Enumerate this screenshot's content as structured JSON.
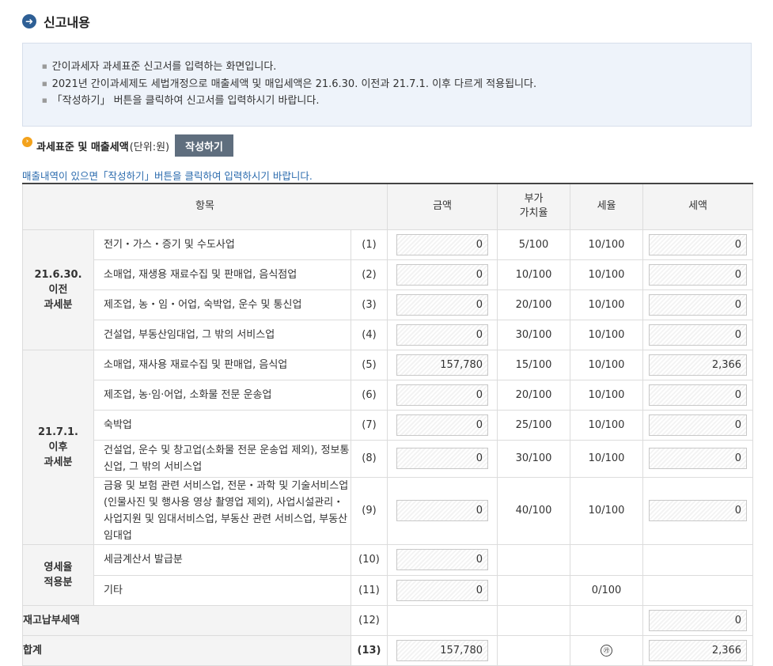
{
  "header": {
    "title": "신고내용",
    "icon": "arrow-right-circle-icon"
  },
  "notice": [
    "간이과세자 과세표준 신고서를 입력하는 화면입니다.",
    "2021년 간이과세제도 세법개정으로 매출세액 및 매입세액은 21.6.30. 이전과 21.7.1. 이후 다르게 적용됩니다.",
    "「작성하기」 버튼을 클릭하여 신고서를 입력하시기 바랍니다."
  ],
  "section": {
    "title": "과세표준 및 매출세액",
    "unit": "(단위:원)",
    "write_button": "작성하기",
    "hint": "매출내역이 있으면「작성하기」버튼을 클릭하여 입력하시기 바랍니다."
  },
  "table": {
    "headers": {
      "item": "항목",
      "amount": "금액",
      "rate": "부가\n가치율",
      "taxrate": "세율",
      "tax": "세액"
    },
    "groups": {
      "before": "21.6.30.\n이전\n과세분",
      "after": "21.7.1.\n이후\n과세분",
      "zero": "영세율\n적용분"
    },
    "rows": [
      {
        "label": "전기・가스・증기 및 수도사업",
        "num": "(1)",
        "amount": "0",
        "rate": "5/100",
        "taxrate": "10/100",
        "tax": "0"
      },
      {
        "label": "소매업, 재생용 재료수집 및 판매업, 음식점업",
        "num": "(2)",
        "amount": "0",
        "rate": "10/100",
        "taxrate": "10/100",
        "tax": "0"
      },
      {
        "label": "제조업, 농・임・어업, 숙박업, 운수 및 통신업",
        "num": "(3)",
        "amount": "0",
        "rate": "20/100",
        "taxrate": "10/100",
        "tax": "0"
      },
      {
        "label": "건설업, 부동산임대업, 그 밖의 서비스업",
        "num": "(4)",
        "amount": "0",
        "rate": "30/100",
        "taxrate": "10/100",
        "tax": "0"
      },
      {
        "label": "소매업, 재사용 재료수집 및 판매업, 음식업",
        "num": "(5)",
        "amount": "157,780",
        "rate": "15/100",
        "taxrate": "10/100",
        "tax": "2,366"
      },
      {
        "label": "제조업, 농·임·어업, 소화물 전문 운송업",
        "num": "(6)",
        "amount": "0",
        "rate": "20/100",
        "taxrate": "10/100",
        "tax": "0"
      },
      {
        "label": "숙박업",
        "num": "(7)",
        "amount": "0",
        "rate": "25/100",
        "taxrate": "10/100",
        "tax": "0"
      },
      {
        "label": "건설업, 운수 및 창고업(소화물 전문 운송업 제외), 정보통신업, 그 밖의 서비스업",
        "num": "(8)",
        "amount": "0",
        "rate": "30/100",
        "taxrate": "10/100",
        "tax": "0"
      },
      {
        "label": "금융 및 보험 관련 서비스업, 전문・과학 및 기술서비스업(인물사진 및 행사용 영상 촬영업 제외), 사업시설관리・사업지원 및 임대서비스업, 부동산 관련 서비스업, 부동산임대업",
        "num": "(9)",
        "amount": "0",
        "rate": "40/100",
        "taxrate": "10/100",
        "tax": "0"
      },
      {
        "label": "세금계산서 발급분",
        "num": "(10)",
        "amount": "0"
      },
      {
        "label": "기타",
        "num": "(11)",
        "amount": "0",
        "taxrate": "0/100"
      }
    ],
    "stock": {
      "label": "재고납부세액",
      "num": "(12)",
      "tax": "0"
    },
    "total": {
      "label": "합계",
      "num": "(13)",
      "amount": "157,780",
      "mark": "㉮",
      "tax": "2,366"
    }
  }
}
